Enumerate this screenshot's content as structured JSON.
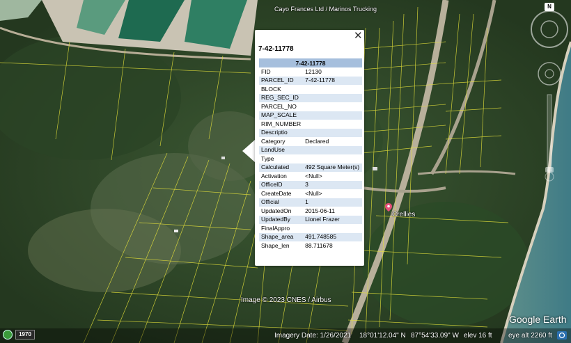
{
  "map": {
    "top_label": "Cayo Frances Ltd / Marinos Trucking",
    "place_label": "Crellies",
    "copyright": "Image © 2023 CNES / Airbus"
  },
  "nav": {
    "north_label": "N"
  },
  "status_bar": {
    "year_badge": "1970",
    "imagery_date": "Imagery Date: 1/26/2021",
    "lat": "18°01'12.04\" N",
    "lon": "87°54'33.09\" W",
    "elev": "elev   16 ft",
    "eye_alt": "eye alt  2260 ft",
    "logo": "Google Earth"
  },
  "balloon": {
    "title": "7-42-11778",
    "header": "7-42-11778",
    "close_label": "✕",
    "rows": [
      {
        "key": "FID",
        "value": "12130"
      },
      {
        "key": "PARCEL_ID",
        "value": "7-42-11778"
      },
      {
        "key": "BLOCK",
        "value": ""
      },
      {
        "key": "REG_SEC_ID",
        "value": ""
      },
      {
        "key": "PARCEL_NO",
        "value": ""
      },
      {
        "key": "MAP_SCALE",
        "value": ""
      },
      {
        "key": "RIM_NUMBER",
        "value": ""
      },
      {
        "key": "Descriptio",
        "value": ""
      },
      {
        "key": "Category",
        "value": "Declared"
      },
      {
        "key": "LandUse",
        "value": ""
      },
      {
        "key": "Type",
        "value": ""
      },
      {
        "key": "Calculated",
        "value": "492 Square Meter(s)"
      },
      {
        "key": "Activation",
        "value": "<Null>"
      },
      {
        "key": "OfficeID",
        "value": "3"
      },
      {
        "key": "CreateDate",
        "value": "<Null>"
      },
      {
        "key": "Official",
        "value": "1"
      },
      {
        "key": "UpdatedOn",
        "value": "2015-06-11"
      },
      {
        "key": "UpdatedBy",
        "value": "Lionel Frazer"
      },
      {
        "key": "FinalAppro",
        "value": ""
      },
      {
        "key": "Shape_area",
        "value": "491.748585"
      },
      {
        "key": "Shape_len",
        "value": "88.711678"
      }
    ]
  }
}
